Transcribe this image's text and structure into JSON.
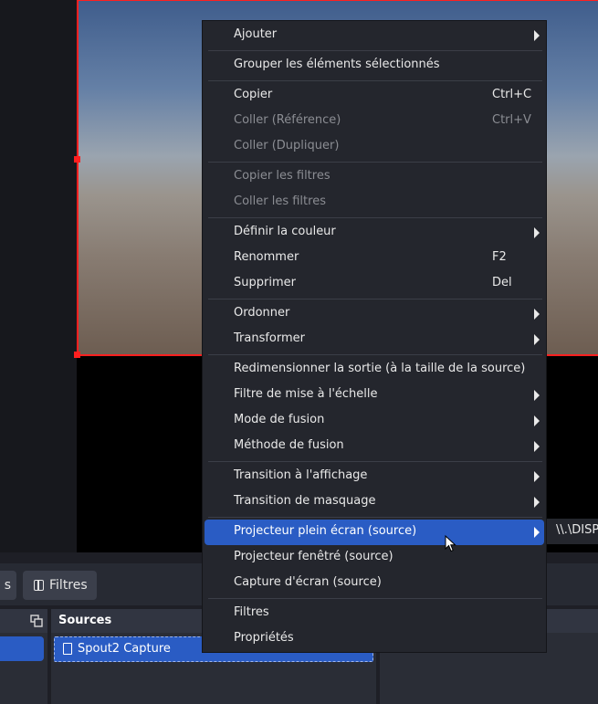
{
  "context_menu": {
    "items": [
      {
        "label": "Ajouter",
        "shortcut": "",
        "submenu": true,
        "disabled": false
      },
      {
        "label": "Grouper les éléments sélectionnés",
        "shortcut": "",
        "submenu": false,
        "disabled": false
      },
      {
        "label": "Copier",
        "shortcut": "Ctrl+C",
        "submenu": false,
        "disabled": false
      },
      {
        "label": "Coller (Référence)",
        "shortcut": "Ctrl+V",
        "submenu": false,
        "disabled": true
      },
      {
        "label": "Coller (Dupliquer)",
        "shortcut": "",
        "submenu": false,
        "disabled": true
      },
      {
        "label": "Copier les filtres",
        "shortcut": "",
        "submenu": false,
        "disabled": true
      },
      {
        "label": "Coller les filtres",
        "shortcut": "",
        "submenu": false,
        "disabled": true
      },
      {
        "label": "Définir la couleur",
        "shortcut": "",
        "submenu": true,
        "disabled": false
      },
      {
        "label": "Renommer",
        "shortcut": "F2",
        "submenu": false,
        "disabled": false
      },
      {
        "label": "Supprimer",
        "shortcut": "Del",
        "submenu": false,
        "disabled": false
      },
      {
        "label": "Ordonner",
        "shortcut": "",
        "submenu": true,
        "disabled": false
      },
      {
        "label": "Transformer",
        "shortcut": "",
        "submenu": true,
        "disabled": false
      },
      {
        "label": "Redimensionner la sortie (à la taille de la source)",
        "shortcut": "",
        "submenu": false,
        "disabled": false
      },
      {
        "label": "Filtre de mise à l'échelle",
        "shortcut": "",
        "submenu": true,
        "disabled": false
      },
      {
        "label": "Mode de fusion",
        "shortcut": "",
        "submenu": true,
        "disabled": false
      },
      {
        "label": "Méthode de fusion",
        "shortcut": "",
        "submenu": true,
        "disabled": false
      },
      {
        "label": "Transition à l'affichage",
        "shortcut": "",
        "submenu": true,
        "disabled": false
      },
      {
        "label": "Transition de masquage",
        "shortcut": "",
        "submenu": true,
        "disabled": false
      },
      {
        "label": "Projecteur plein écran (source)",
        "shortcut": "",
        "submenu": true,
        "disabled": false,
        "highlighted": true
      },
      {
        "label": "Projecteur fenêtré (source)",
        "shortcut": "",
        "submenu": false,
        "disabled": false
      },
      {
        "label": "Capture d'écran (source)",
        "shortcut": "",
        "submenu": false,
        "disabled": false
      },
      {
        "label": "Filtres",
        "shortcut": "",
        "submenu": false,
        "disabled": false
      },
      {
        "label": "Propriétés",
        "shortcut": "",
        "submenu": false,
        "disabled": false
      }
    ]
  },
  "submenu": {
    "label": "\\\\.\\DISP"
  },
  "toolbar": {
    "partial_button_label": "s",
    "filters_label": "Filtres"
  },
  "sources": {
    "title": "Sources",
    "items": [
      {
        "label": "Spout2 Capture"
      }
    ]
  },
  "colors": {
    "accent": "#2a5cc4",
    "selection_outline": "#ff1f1f"
  }
}
